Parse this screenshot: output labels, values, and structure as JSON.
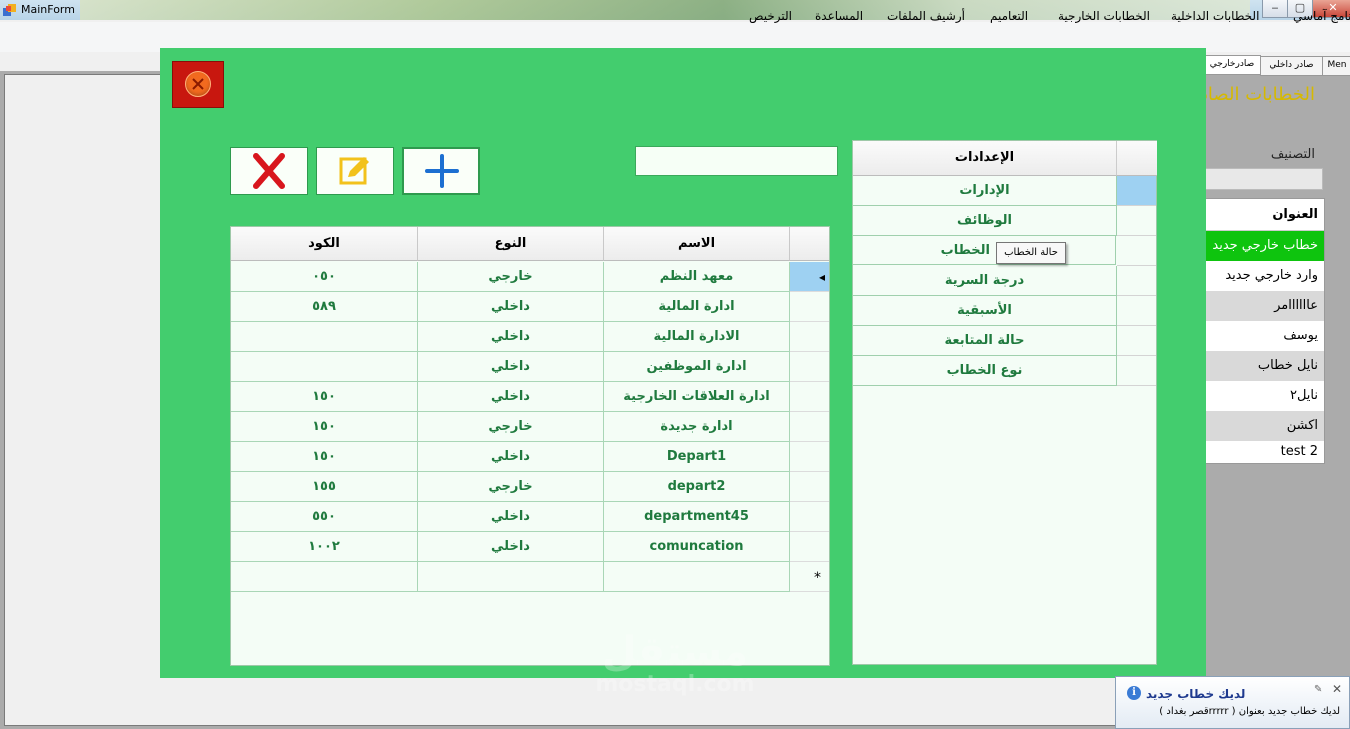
{
  "window": {
    "title": "MainForm",
    "minimize": "‒",
    "maximize": "▢",
    "close": "✕",
    "icon": "app-form-icon"
  },
  "menu": [
    "برنامج آماسي",
    "الخطابات الداخلية",
    "الخطابات الخارجية",
    "التعاميم",
    "أرشيف الملفات",
    "المساعدة",
    "الترخيص"
  ],
  "tabs": [
    "صادرخارجي",
    "صادر داخلي",
    "Men"
  ],
  "background_form": {
    "title": "الخطابات الصادرة",
    "classify_label": "التصنيف",
    "list_header": "العنوان",
    "list_items": [
      "خطاب خارجي جديد",
      "وارد خارجي جديد",
      "عاااااامر",
      "يوسف",
      "نايل خطاب",
      "نايل٢",
      "اكشن",
      "test 2"
    ]
  },
  "dialog": {
    "close_icon": "close-circle-icon",
    "search": {
      "value": "",
      "placeholder": ""
    },
    "buttons": {
      "delete_icon": "red-x-icon",
      "edit_icon": "edit-pencil-icon",
      "add_icon": "plus-icon"
    },
    "settings": {
      "header": "الإعدادات",
      "items": [
        "الإدارات",
        "الوظائف",
        "الخطاب",
        "درجة السرية",
        "الأسبقية",
        "حالة المتابعة",
        "نوع الخطاب"
      ],
      "tooltip": "حالة الخطاب"
    },
    "grid": {
      "headers": {
        "name": "الاسم",
        "type": "النوع",
        "code": "الكود"
      },
      "rows": [
        {
          "name": "معهد النظم",
          "type": "خارجي",
          "code": "٠٥٠"
        },
        {
          "name": "ادارة المالية",
          "type": "داخلي",
          "code": "٥٨٩"
        },
        {
          "name": "الادارة المالية",
          "type": "داخلي",
          "code": ""
        },
        {
          "name": "ادارة الموظفين",
          "type": "داخلي",
          "code": ""
        },
        {
          "name": "ادارة العلاقات الخارجية",
          "type": "داخلي",
          "code": "١٥٠"
        },
        {
          "name": "ادارة جديدة",
          "type": "خارجي",
          "code": "١٥٠"
        },
        {
          "name": "Depart1",
          "type": "داخلي",
          "code": "١٥٠"
        },
        {
          "name": "depart2",
          "type": "خارجي",
          "code": "١٥٥"
        },
        {
          "name": "department45",
          "type": "داخلي",
          "code": "٥٥٠"
        },
        {
          "name": "comuncation",
          "type": "داخلي",
          "code": "١٠٠٢"
        }
      ],
      "new_row_marker": "*",
      "current_row_marker": "◂"
    }
  },
  "notification": {
    "title": "لديك خطاب جديد",
    "body": "لديك خطاب جديد بعنوان ( rrrrrقصر بغداد )",
    "icon": "info-icon",
    "pin_icon": "pin-icon",
    "close": "✕"
  },
  "watermark": {
    "arabic": "مستقل",
    "latin": "mostaql.com"
  },
  "colors": {
    "dialog_bg": "#43cd6e",
    "cell_text": "#1f7a3e",
    "close_btn": "#c8170f",
    "selected_row": "#0ec40e"
  }
}
